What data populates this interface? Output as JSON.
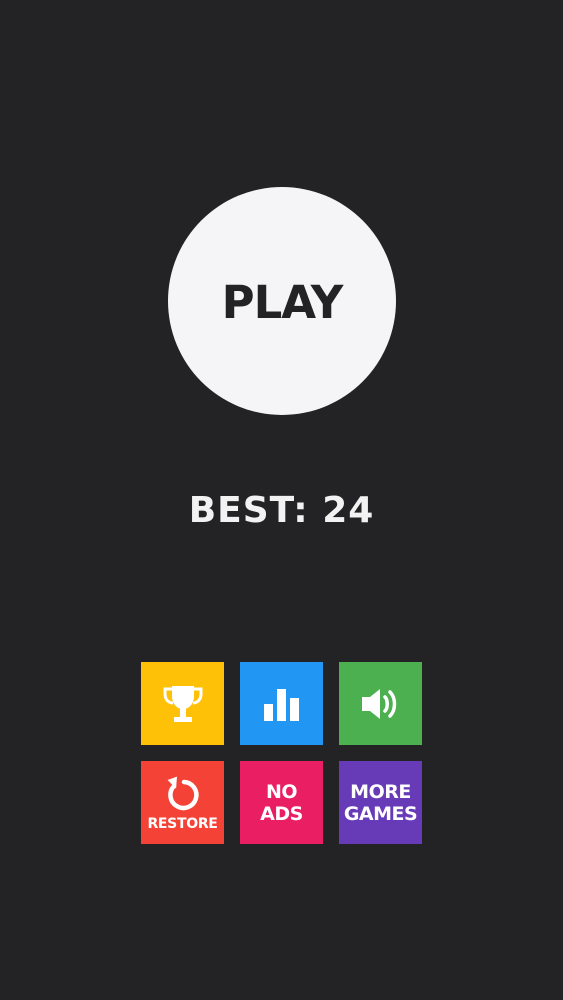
{
  "play": {
    "label": "PLAY"
  },
  "best": {
    "label": "BEST:",
    "value": "24"
  },
  "tiles": {
    "achievements": {
      "icon": "trophy-icon",
      "color": "#ffc107"
    },
    "leaderboard": {
      "icon": "bar-chart-icon",
      "color": "#2196f3"
    },
    "sound": {
      "icon": "speaker-icon",
      "color": "#4caf50"
    },
    "restore": {
      "icon": "restore-arrow-icon",
      "label": "RESTORE",
      "color": "#f44336"
    },
    "no_ads": {
      "line1": "NO",
      "line2": "ADS",
      "color": "#e91e63"
    },
    "more_games": {
      "line1": "MORE",
      "line2": "GAMES",
      "color": "#673ab7"
    }
  }
}
